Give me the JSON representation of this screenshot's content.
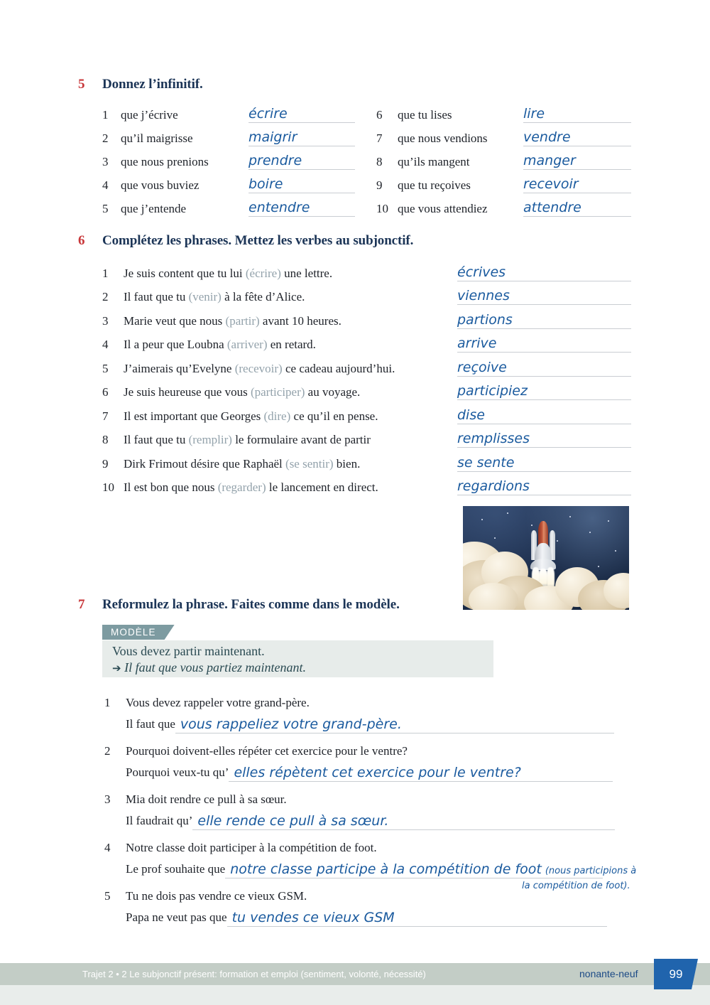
{
  "exercise5": {
    "number": "5",
    "title": "Donnez l’infinitif.",
    "left_items": [
      {
        "n": "1",
        "prompt": "que j’écrive",
        "answer": "écrire"
      },
      {
        "n": "2",
        "prompt": "qu’il maigrisse",
        "answer": "maigrir"
      },
      {
        "n": "3",
        "prompt": "que nous prenions",
        "answer": "prendre"
      },
      {
        "n": "4",
        "prompt": "que vous buviez",
        "answer": "boire"
      },
      {
        "n": "5",
        "prompt": "que j’entende",
        "answer": "entendre"
      }
    ],
    "right_items": [
      {
        "n": "6",
        "prompt": "que tu lises",
        "answer": "lire"
      },
      {
        "n": "7",
        "prompt": "que nous vendions",
        "answer": "vendre"
      },
      {
        "n": "8",
        "prompt": "qu’ils mangent",
        "answer": "manger"
      },
      {
        "n": "9",
        "prompt": "que tu reçoives",
        "answer": "recevoir"
      },
      {
        "n": "10",
        "prompt": "que vous attendiez",
        "answer": "attendre"
      }
    ]
  },
  "exercise6": {
    "number": "6",
    "title": "Complétez les phrases. Mettez les verbes au subjonctif.",
    "items": [
      {
        "n": "1",
        "before": "Je suis content que tu lui ",
        "inf": "(écrire)",
        "after": " une lettre.",
        "answer": "écrives"
      },
      {
        "n": "2",
        "before": "Il faut que tu ",
        "inf": "(venir)",
        "after": " à la fête d’Alice.",
        "answer": "viennes"
      },
      {
        "n": "3",
        "before": "Marie veut que nous ",
        "inf": "(partir)",
        "after": " avant 10 heures.",
        "answer": "partions"
      },
      {
        "n": "4",
        "before": "Il a peur que Loubna ",
        "inf": "(arriver)",
        "after": " en retard.",
        "answer": "arrive"
      },
      {
        "n": "5",
        "before": "J’aimerais qu’Evelyne ",
        "inf": "(recevoir)",
        "after": " ce cadeau aujourd’hui.",
        "answer": "reçoive"
      },
      {
        "n": "6",
        "before": "Je suis heureuse que vous ",
        "inf": "(participer)",
        "after": " au voyage.",
        "answer": "participiez"
      },
      {
        "n": "7",
        "before": "Il est important que Georges ",
        "inf": "(dire)",
        "after": " ce qu’il en pense.",
        "answer": "dise"
      },
      {
        "n": "8",
        "before": "Il faut que tu ",
        "inf": "(remplir)",
        "after": " le formulaire avant de partir",
        "answer": "remplisses"
      },
      {
        "n": "9",
        "before": "Dirk Frimout désire que Raphaël ",
        "inf": "(se sentir)",
        "after": " bien.",
        "answer": "se sente"
      },
      {
        "n": "10",
        "before": "Il est bon que nous ",
        "inf": "(regarder)",
        "after": " le lancement en direct.",
        "answer": "regardions"
      }
    ]
  },
  "photo": {
    "caption": "space-shuttle-launch-photo"
  },
  "exercise7": {
    "number": "7",
    "title": "Reformulez la phrase. Faites comme dans le modèle.",
    "model": {
      "tab_label": "MODÈLE",
      "line1": "Vous devez partir maintenant.",
      "arrow": "➔",
      "line2": "Il faut que vous partiez maintenant."
    },
    "items": [
      {
        "n": "1",
        "question": "Vous devez rappeler votre grand-père.",
        "stem": "Il faut que",
        "answer": "vous rappeliez votre grand-père.",
        "answer_extra": ""
      },
      {
        "n": "2",
        "question": "Pourquoi doivent-elles répéter cet exercice pour le ventre?",
        "stem": "Pourquoi veux-tu qu’",
        "answer": "elles répètent cet exercice pour le ventre?",
        "answer_extra": ""
      },
      {
        "n": "3",
        "question": "Mia doit rendre ce pull à sa sœur.",
        "stem": "Il faudrait qu’",
        "answer": "elle rende ce pull à sa sœur.",
        "answer_extra": ""
      },
      {
        "n": "4",
        "question": "Notre classe doit participer à la compétition de foot.",
        "stem": "Le prof souhaite que",
        "answer": "notre classe participe à la compétition de foot",
        "answer_extra": "(nous participions à",
        "answer_extra2": "la compétition de foot)."
      },
      {
        "n": "5",
        "question": "Tu ne dois pas vendre ce vieux GSM.",
        "stem": "Papa ne veut pas que",
        "answer": "tu vendes ce vieux GSM",
        "answer_extra": ""
      }
    ]
  },
  "footer": {
    "text": "Trajet 2 • 2 Le subjonctif présent: formation et emploi (sentiment, volonté, nécessité)",
    "page_word": "nonante-neuf",
    "page_number": "99"
  },
  "colors": {
    "exercise_number": "#c8373a",
    "heading": "#1c3557",
    "handwriting": "#1a5a9e",
    "infinitive_hint": "#93a2ab",
    "model_tab": "#7d9ba1",
    "model_box": "#e7ecea",
    "footer_bar": "#c3cdc6",
    "page_box": "#2064ad"
  }
}
